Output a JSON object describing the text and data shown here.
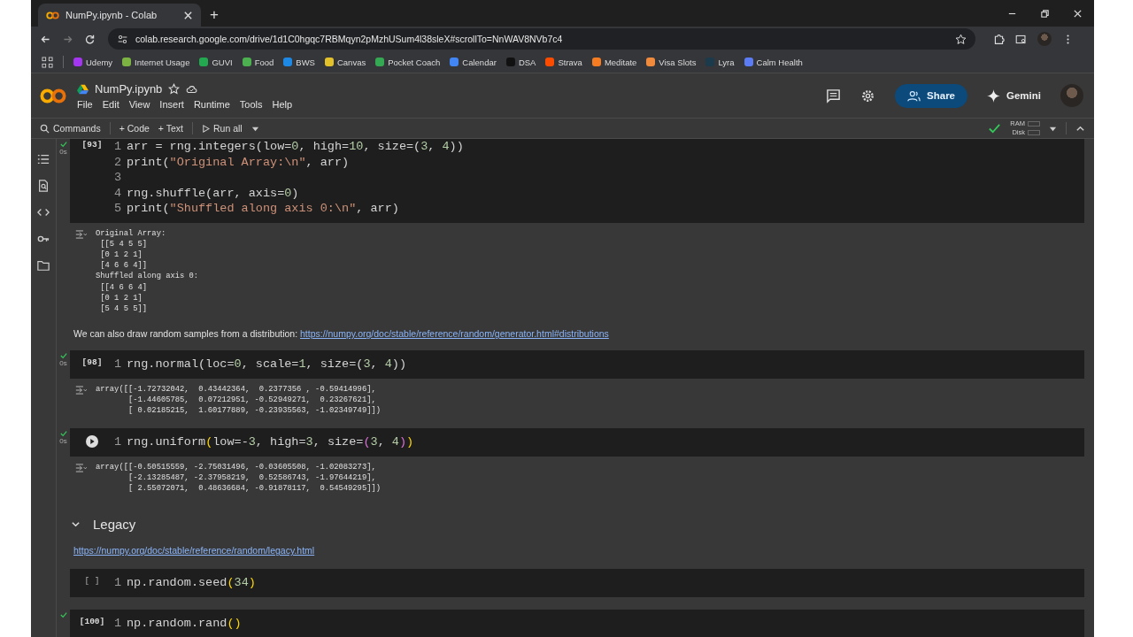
{
  "browser": {
    "tab": {
      "title": "NumPy.ipynb - Colab"
    },
    "new_tab": "+",
    "url": "colab.research.google.com/drive/1d1C0hgqc7RBMqyn2pMzhUSum4l38sleX#scrollTo=NnWAV8NVb7c4",
    "bookmarks": [
      {
        "label": "Udemy",
        "color": "#a435f0"
      },
      {
        "label": "Internet Usage",
        "color": "#7cb342"
      },
      {
        "label": "GUVI",
        "color": "#22a94f"
      },
      {
        "label": "Food",
        "color": "#4caf50"
      },
      {
        "label": "BWS",
        "color": "#1e88e5"
      },
      {
        "label": "Canvas",
        "color": "#e3c12a"
      },
      {
        "label": "Pocket Coach",
        "color": "#34a853"
      },
      {
        "label": "Calendar",
        "color": "#4285f4"
      },
      {
        "label": "DSA",
        "color": "#111111"
      },
      {
        "label": "Strava",
        "color": "#fc4c02"
      },
      {
        "label": "Meditate",
        "color": "#f57c20"
      },
      {
        "label": "Visa Slots",
        "color": "#f08a3c"
      },
      {
        "label": "Lyra",
        "color": "#1b3a4b"
      },
      {
        "label": "Calm Health",
        "color": "#5b7cf5"
      }
    ]
  },
  "colab": {
    "notebook_title": "NumPy.ipynb",
    "menu": [
      "File",
      "Edit",
      "View",
      "Insert",
      "Runtime",
      "Tools",
      "Help"
    ],
    "share": "Share",
    "gemini": "Gemini",
    "toolbar": {
      "commands": "Commands",
      "add_code": "+ Code",
      "add_text": "+ Text",
      "run_all": "Run all"
    },
    "resources": {
      "ram": "RAM",
      "disk": "Disk",
      "connected": true
    }
  },
  "cells": [
    {
      "kind": "code",
      "count": "[93]",
      "ran": true,
      "time": "0s",
      "run_button": false,
      "lines": [
        {
          "no": "1",
          "tokens": [
            {
              "kind": "plain",
              "text": "arr = rng.integers(low="
            },
            {
              "kind": "number",
              "text": "0"
            },
            {
              "kind": "plain",
              "text": ", high="
            },
            {
              "kind": "number",
              "text": "10"
            },
            {
              "kind": "plain",
              "text": ", size=("
            },
            {
              "kind": "number",
              "text": "3"
            },
            {
              "kind": "plain",
              "text": ", "
            },
            {
              "kind": "number",
              "text": "4"
            },
            {
              "kind": "plain",
              "text": "))"
            }
          ]
        },
        {
          "no": "2",
          "tokens": [
            {
              "kind": "plain",
              "text": "print("
            },
            {
              "kind": "string",
              "text": "\"Original Array:\\n\""
            },
            {
              "kind": "plain",
              "text": ", arr)"
            }
          ]
        },
        {
          "no": "3"
        },
        {
          "no": "4",
          "tokens": [
            {
              "kind": "plain",
              "text": "rng.shuffle(arr, axis="
            },
            {
              "kind": "number",
              "text": "0"
            },
            {
              "kind": "plain",
              "text": ")"
            }
          ]
        },
        {
          "no": "5",
          "tokens": [
            {
              "kind": "plain",
              "text": "print("
            },
            {
              "kind": "string",
              "text": "\"Shuffled along axis 0:\\n\""
            },
            {
              "kind": "plain",
              "text": ", arr)"
            }
          ]
        }
      ],
      "output": [
        "Original Array:",
        " [[5 4 5 5]",
        " [0 1 2 1]",
        " [4 6 6 4]]",
        "Shuffled along axis 0:",
        " [[4 6 6 4]",
        " [0 1 2 1]",
        " [5 4 5 5]]"
      ]
    },
    {
      "kind": "text",
      "text": "We can also draw random samples from a distribution: ",
      "link": "https://numpy.org/doc/stable/reference/random/generator.html#distributions"
    },
    {
      "kind": "code",
      "count": "[98]",
      "ran": true,
      "time": "0s",
      "run_button": false,
      "lines": [
        {
          "no": "1",
          "tokens": [
            {
              "kind": "plain",
              "text": "rng.normal(loc="
            },
            {
              "kind": "number",
              "text": "0"
            },
            {
              "kind": "plain",
              "text": ", scale="
            },
            {
              "kind": "number",
              "text": "1"
            },
            {
              "kind": "plain",
              "text": ", size=("
            },
            {
              "kind": "number",
              "text": "3"
            },
            {
              "kind": "plain",
              "text": ", "
            },
            {
              "kind": "number",
              "text": "4"
            },
            {
              "kind": "plain",
              "text": "))"
            }
          ]
        }
      ],
      "output": [
        "array([[-1.72732042,  0.43442364,  0.2377356 , -0.59414996],",
        "       [-1.44605785,  0.07212951, -0.52949271,  0.23267621],",
        "       [ 0.02185215,  1.60177889, -0.23935563, -1.02349749]])"
      ]
    },
    {
      "kind": "code",
      "ran": true,
      "time": "0s",
      "run_button": true,
      "lines": [
        {
          "no": "1",
          "tokens": [
            {
              "kind": "plain",
              "text": "rng.uniform"
            },
            {
              "kind": "bracket",
              "text": "("
            },
            {
              "kind": "plain",
              "text": "low=-"
            },
            {
              "kind": "number",
              "text": "3"
            },
            {
              "kind": "plain",
              "text": ", high="
            },
            {
              "kind": "number",
              "text": "3"
            },
            {
              "kind": "plain",
              "text": ", size="
            },
            {
              "kind": "bracket2",
              "text": "("
            },
            {
              "kind": "number",
              "text": "3"
            },
            {
              "kind": "plain",
              "text": ", "
            },
            {
              "kind": "number",
              "text": "4"
            },
            {
              "kind": "bracket2",
              "text": ")"
            },
            {
              "kind": "bracket",
              "text": ")"
            }
          ]
        }
      ],
      "output": [
        "array([[-0.50515559, -2.75031496, -0.03605508, -1.02083273],",
        "       [-2.13285487, -2.37958219,  0.52586743, -1.97644219],",
        "       [ 2.55072071,  0.48636684, -0.91878117,  0.54549295]])"
      ]
    },
    {
      "kind": "heading",
      "text": "Legacy",
      "expanded": true
    },
    {
      "kind": "link",
      "link": "https://numpy.org/doc/stable/reference/random/legacy.html"
    },
    {
      "kind": "code",
      "count": "[ ]",
      "ran": false,
      "run_button": false,
      "lines": [
        {
          "no": "1",
          "tokens": [
            {
              "kind": "plain",
              "text": "np.random.seed"
            },
            {
              "kind": "bracket",
              "text": "("
            },
            {
              "kind": "number",
              "text": "34"
            },
            {
              "kind": "bracket",
              "text": ")"
            }
          ]
        }
      ]
    },
    {
      "kind": "code",
      "count": "[100]",
      "ran": true,
      "run_button": false,
      "lines": [
        {
          "no": "1",
          "tokens": [
            {
              "kind": "plain",
              "text": "np.random.rand"
            },
            {
              "kind": "bracket",
              "text": "()"
            }
          ]
        }
      ]
    }
  ]
}
